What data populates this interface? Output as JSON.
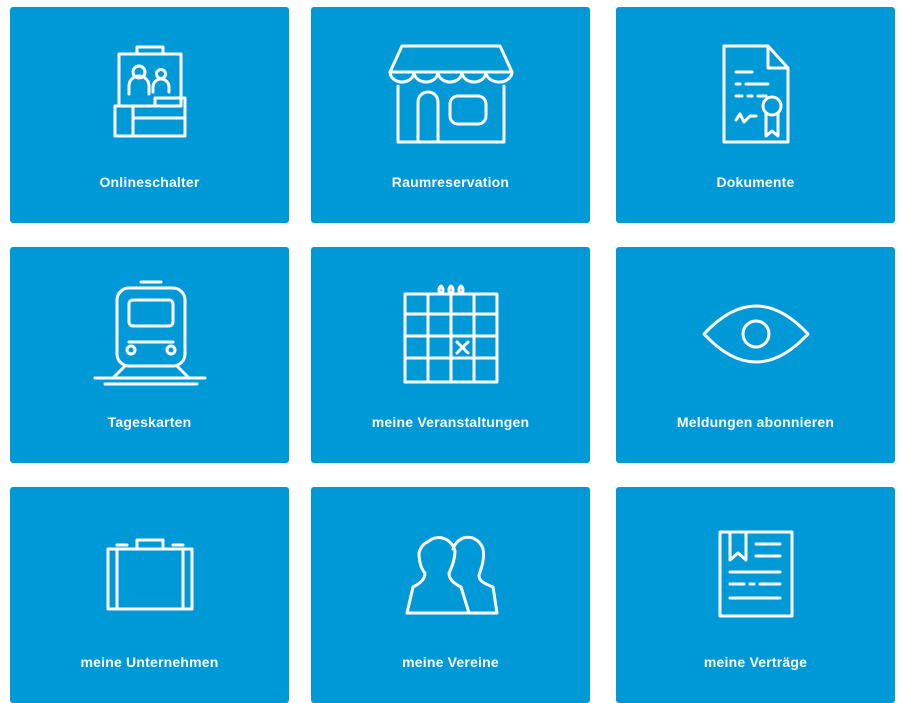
{
  "tiles": [
    {
      "label": "Onlineschalter",
      "icon": "counter-icon"
    },
    {
      "label": "Raumreservation",
      "icon": "shop-icon"
    },
    {
      "label": "Dokumente",
      "icon": "document-icon"
    },
    {
      "label": "Tageskarten",
      "icon": "train-icon"
    },
    {
      "label": "meine Veranstaltungen",
      "icon": "calendar-icon"
    },
    {
      "label": "Meldungen abonnieren",
      "icon": "eye-icon"
    },
    {
      "label": "meine Unternehmen",
      "icon": "briefcase-icon"
    },
    {
      "label": "meine Vereine",
      "icon": "people-icon"
    },
    {
      "label": "meine Verträge",
      "icon": "contract-icon"
    }
  ],
  "colors": {
    "tile_background": "#0099d8",
    "icon_and_text": "#ffffff",
    "page_background": "#ffffff"
  }
}
